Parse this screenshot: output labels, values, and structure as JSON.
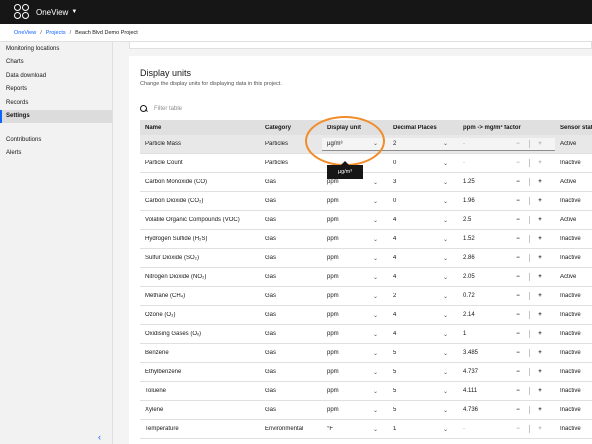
{
  "header": {
    "app_name": "OneView"
  },
  "breadcrumb": {
    "items": [
      "OneView",
      "Projects"
    ],
    "current": "Beach Blvd Demo Project"
  },
  "sidebar": {
    "items": [
      {
        "label": "Monitoring locations"
      },
      {
        "label": "Charts"
      },
      {
        "label": "Data download"
      },
      {
        "label": "Reports"
      },
      {
        "label": "Records"
      },
      {
        "label": "Settings",
        "active": true
      }
    ],
    "items2": [
      {
        "label": "Contributions"
      },
      {
        "label": "Alerts"
      }
    ]
  },
  "main": {
    "title": "Display units",
    "subtitle": "Change the display units for displaying data in this project.",
    "search_placeholder": "Filter table",
    "columns": [
      "Name",
      "Category",
      "Display unit",
      "Decimal Places",
      "ppm -> mg/m³ factor",
      "Sensor status"
    ],
    "tooltip": "µg/m³",
    "rows": [
      {
        "name": "Particle Mass",
        "category": "Particles",
        "unit": "µg/m³",
        "decimals": "2",
        "factor": "-",
        "status": "Active"
      },
      {
        "name": "Particle Count",
        "category": "Particles",
        "unit": "",
        "decimals": "0",
        "factor": "-",
        "status": "Inactive"
      },
      {
        "name": "Carbon Monoxide (CO)",
        "category": "Gas",
        "unit": "ppm",
        "decimals": "3",
        "factor": "1.25",
        "status": "Active"
      },
      {
        "name": "Carbon Dioxide (CO₂)",
        "category": "Gas",
        "unit": "ppm",
        "decimals": "0",
        "factor": "1.96",
        "status": "Inactive"
      },
      {
        "name": "Volatile Organic Compounds (VOC)",
        "category": "Gas",
        "unit": "ppm",
        "decimals": "4",
        "factor": "2.5",
        "status": "Active"
      },
      {
        "name": "Hydrogen Sulfide (H₂S)",
        "category": "Gas",
        "unit": "ppm",
        "decimals": "4",
        "factor": "1.52",
        "status": "Inactive"
      },
      {
        "name": "Sulfur Dioxide (SO₂)",
        "category": "Gas",
        "unit": "ppm",
        "decimals": "4",
        "factor": "2.86",
        "status": "Inactive"
      },
      {
        "name": "Nitrogen Dioxide (NO₂)",
        "category": "Gas",
        "unit": "ppm",
        "decimals": "4",
        "factor": "2.05",
        "status": "Active"
      },
      {
        "name": "Methane (CH₄)",
        "category": "Gas",
        "unit": "ppm",
        "decimals": "2",
        "factor": "0.72",
        "status": "Inactive"
      },
      {
        "name": "Ozone (O₃)",
        "category": "Gas",
        "unit": "ppm",
        "decimals": "4",
        "factor": "2.14",
        "status": "Inactive"
      },
      {
        "name": "Oxidising Gases (Oₓ)",
        "category": "Gas",
        "unit": "ppm",
        "decimals": "4",
        "factor": "1",
        "status": "Inactive"
      },
      {
        "name": "Benzene",
        "category": "Gas",
        "unit": "ppm",
        "decimals": "5",
        "factor": "3.485",
        "status": "Inactive"
      },
      {
        "name": "Ethylbenzene",
        "category": "Gas",
        "unit": "ppm",
        "decimals": "5",
        "factor": "4.737",
        "status": "Inactive"
      },
      {
        "name": "Toluene",
        "category": "Gas",
        "unit": "ppm",
        "decimals": "5",
        "factor": "4.111",
        "status": "Inactive"
      },
      {
        "name": "Xylene",
        "category": "Gas",
        "unit": "ppm",
        "decimals": "5",
        "factor": "4.736",
        "status": "Inactive"
      },
      {
        "name": "Temperature",
        "category": "Environmental",
        "unit": "°F",
        "decimals": "1",
        "factor": "-",
        "status": "Inactive"
      }
    ]
  },
  "colors": {
    "accent": "#0f62fe",
    "highlight_ring": "#f08c2a",
    "topbar": "#161616"
  }
}
